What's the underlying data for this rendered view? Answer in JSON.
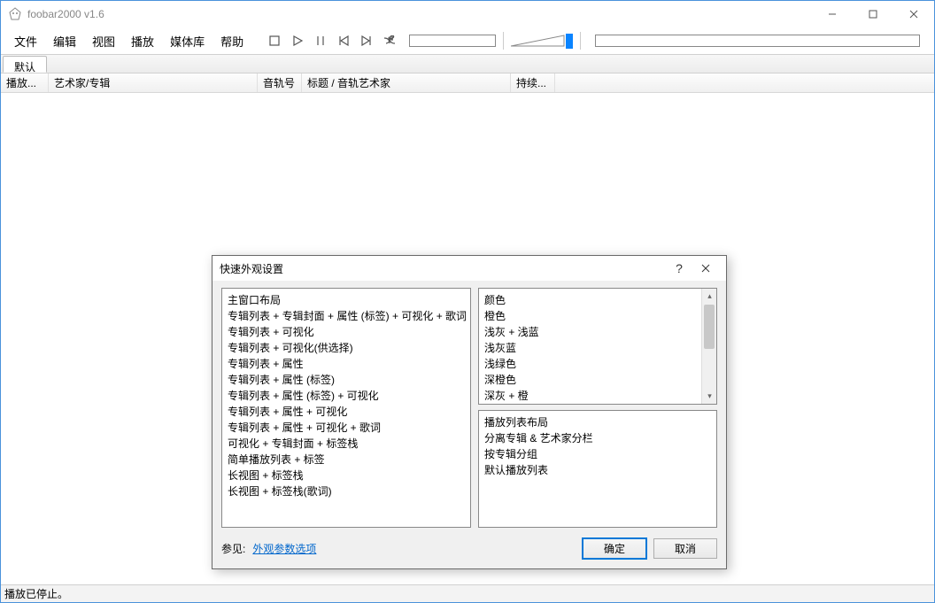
{
  "titlebar": {
    "title": "foobar2000 v1.6"
  },
  "menu": {
    "file": "文件",
    "edit": "编辑",
    "view": "视图",
    "playback": "播放",
    "library": "媒体库",
    "help": "帮助"
  },
  "tabs": {
    "default": "默认"
  },
  "columns": {
    "playing": "播放...",
    "artist_album": "艺术家/专辑",
    "trackno": "音轨号",
    "title_artist": "标题 / 音轨艺术家",
    "duration": "持续..."
  },
  "status": {
    "text": "播放已停止。"
  },
  "dialog": {
    "title": "快速外观设置",
    "help_char": "?",
    "left_header": "主窗口布局",
    "left_items": [
      "专辑列表 + 专辑封面 + 属性 (标签) + 可视化 + 歌词",
      "专辑列表 + 可视化",
      "专辑列表 + 可视化(供选择)",
      "专辑列表 + 属性",
      "专辑列表 + 属性 (标签)",
      "专辑列表 + 属性 (标签) + 可视化",
      "专辑列表 + 属性 + 可视化",
      "专辑列表 + 属性 + 可视化 + 歌词",
      "可视化 + 专辑封面 + 标签栈",
      "简单播放列表 + 标签",
      "长视图 + 标签栈",
      "长视图 + 标签栈(歌词)"
    ],
    "right_top_header": "颜色",
    "right_top_items": [
      "橙色",
      "浅灰 + 浅蓝",
      "浅灰蓝",
      "浅绿色",
      "深橙色",
      "深灰 + 橙"
    ],
    "right_bot_header": "播放列表布局",
    "right_bot_items": [
      "分离专辑 & 艺术家分栏",
      "按专辑分组",
      "默认播放列表"
    ],
    "footer_label": "参见:",
    "footer_link": "外观参数选项",
    "ok": "确定",
    "cancel": "取消"
  }
}
